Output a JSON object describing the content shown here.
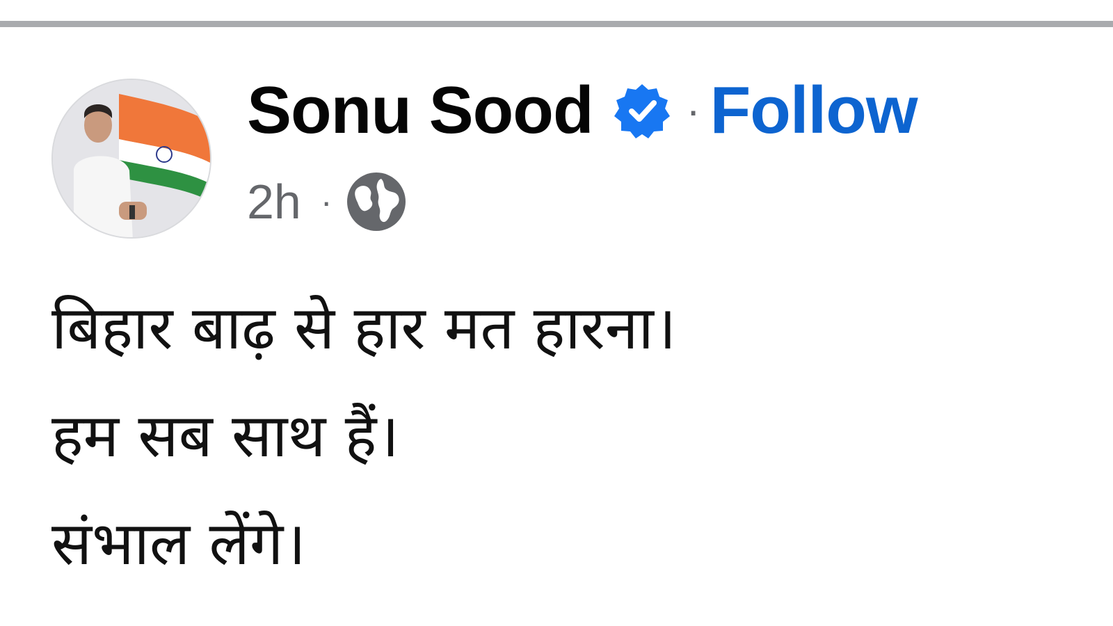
{
  "post": {
    "author": "Sonu Sood",
    "follow_label": "Follow",
    "separator": "·",
    "timestamp": "2h",
    "audience_icon": "globe-icon",
    "verified_icon": "verified-badge-icon",
    "lines": [
      "बिहार बाढ़ से हार मत हारना।",
      "हम सब साथ हैं।",
      "संभाल लेंगे।"
    ]
  },
  "colors": {
    "follow": "#0d64d0",
    "verified": "#1877f2",
    "muted": "#65676b",
    "divider": "#a9abae"
  }
}
